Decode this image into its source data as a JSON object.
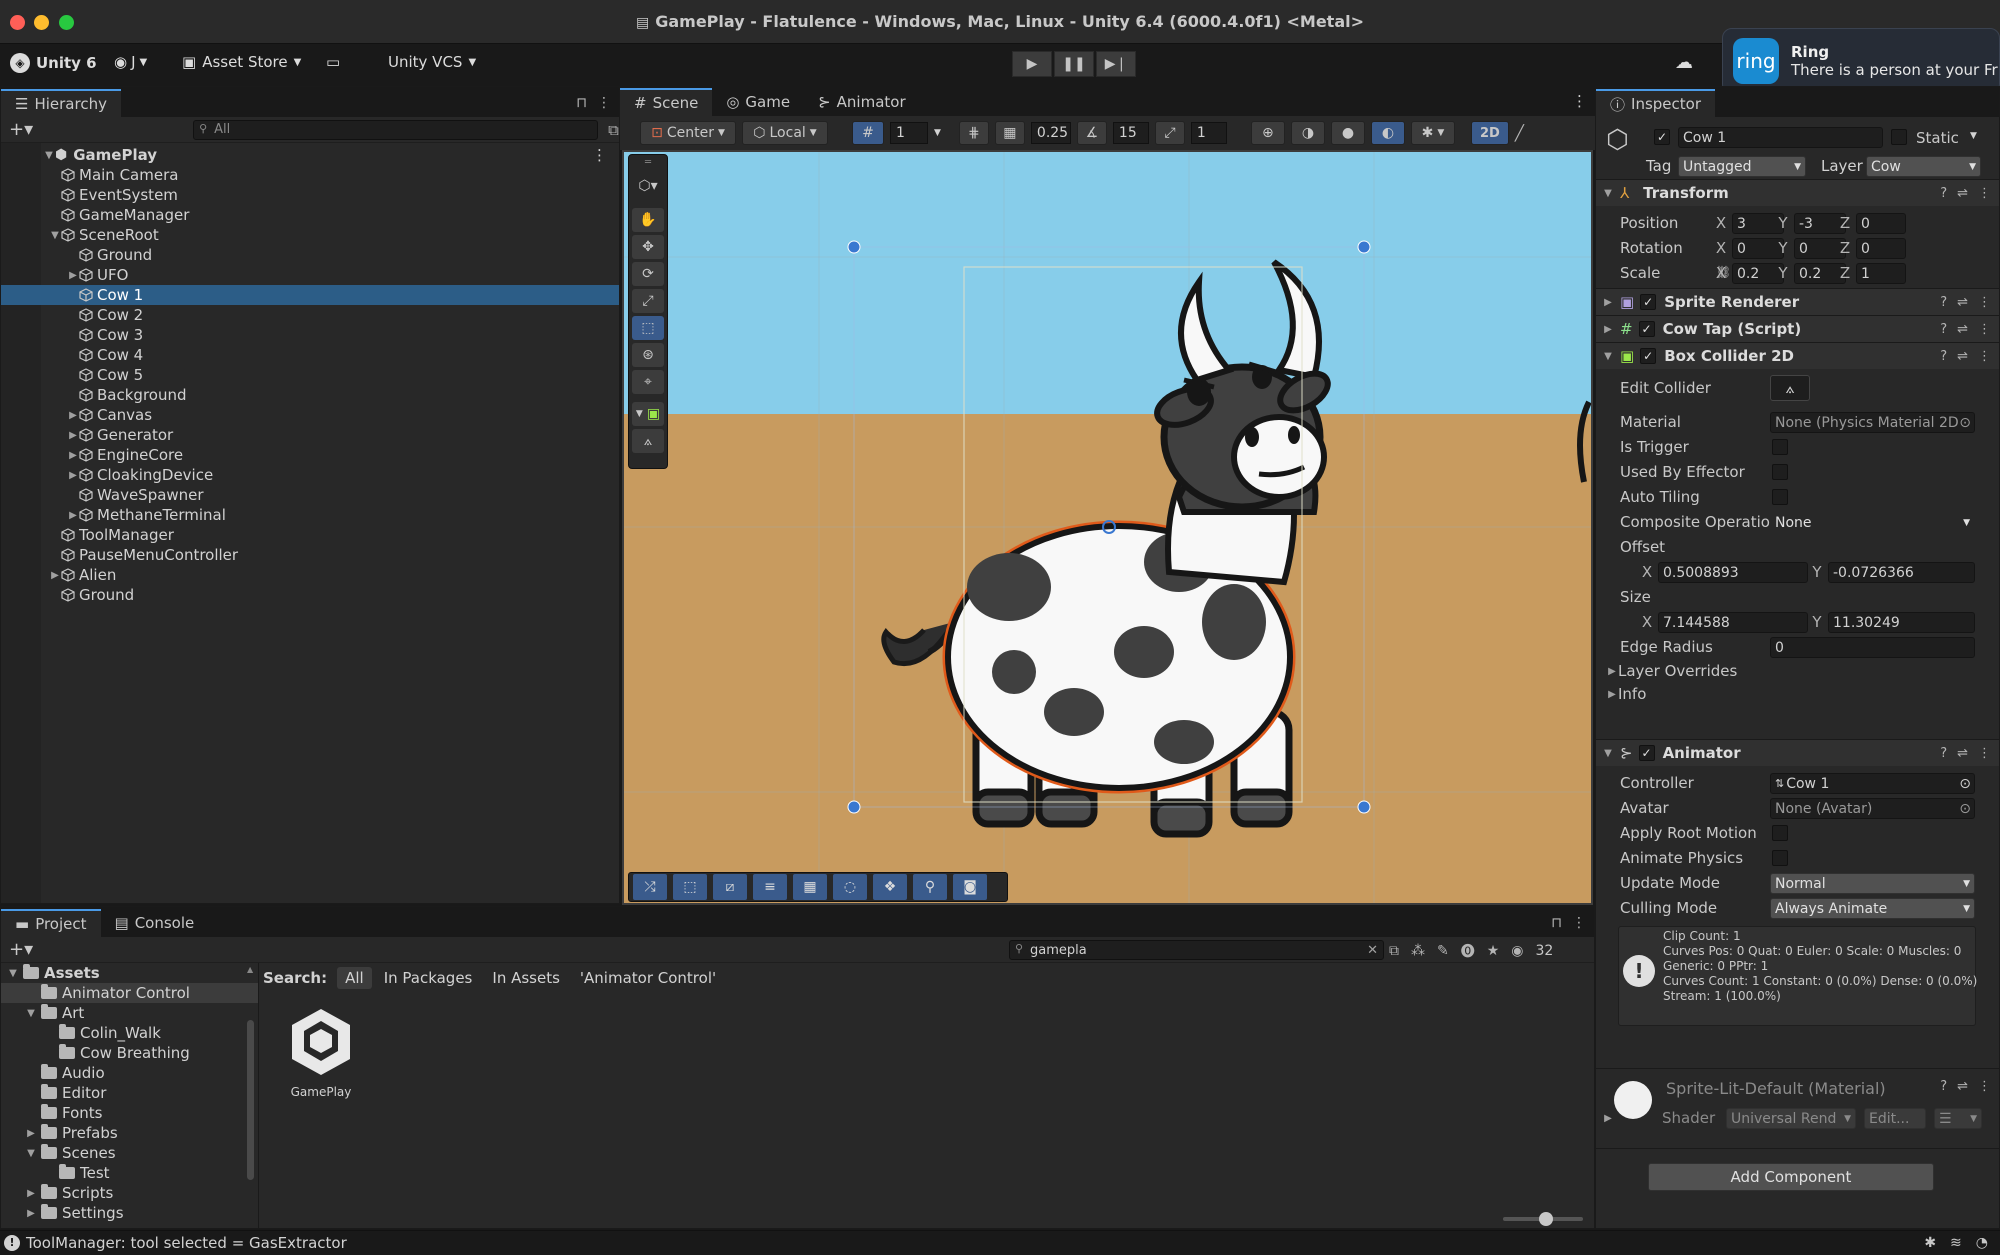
{
  "window": {
    "title": "GamePlay - Flatulence - Windows, Mac, Linux - Unity 6.4 (6000.4.0f1) <Metal>"
  },
  "toolbar": {
    "unity_label": "Unity 6",
    "account_label": "J",
    "asset_store_label": "Asset Store",
    "vcs_label": "Unity VCS"
  },
  "notification": {
    "brand": "ring",
    "title": "Ring",
    "message": "There is a person at your Fr"
  },
  "hierarchy": {
    "tab_label": "Hierarchy",
    "search_placeholder": "All",
    "scene_name": "GamePlay",
    "items": [
      {
        "label": "Main Camera"
      },
      {
        "label": "EventSystem"
      },
      {
        "label": "GameManager"
      },
      {
        "label": "SceneRoot"
      },
      {
        "label": "Ground"
      },
      {
        "label": "UFO"
      },
      {
        "label": "Cow 1"
      },
      {
        "label": "Cow 2"
      },
      {
        "label": "Cow 3"
      },
      {
        "label": "Cow 4"
      },
      {
        "label": "Cow 5"
      },
      {
        "label": "Background"
      },
      {
        "label": "Canvas"
      },
      {
        "label": "Generator"
      },
      {
        "label": "EngineCore"
      },
      {
        "label": "CloakingDevice"
      },
      {
        "label": "WaveSpawner"
      },
      {
        "label": "MethaneTerminal"
      },
      {
        "label": "ToolManager"
      },
      {
        "label": "PauseMenuController"
      },
      {
        "label": "Alien"
      },
      {
        "label": "Ground"
      }
    ]
  },
  "scene": {
    "tabs": [
      {
        "label": "Scene"
      },
      {
        "label": "Game"
      },
      {
        "label": "Animator"
      }
    ],
    "pivot_label": "Center",
    "space_label": "Local",
    "grid_value": "1",
    "snap_value": "0.25",
    "angle_value": "15",
    "scale_snap_value": "1",
    "mode_2d_label": "2D"
  },
  "project": {
    "tabs": [
      {
        "label": "Project"
      },
      {
        "label": "Console"
      }
    ],
    "search_value": "gamepla",
    "count": "32",
    "search_label": "Search:",
    "filters": [
      {
        "label": "All"
      },
      {
        "label": "In Packages"
      },
      {
        "label": "In Assets"
      },
      {
        "label": "'Animator Control'"
      }
    ],
    "tree": [
      {
        "label": "Assets"
      },
      {
        "label": "Animator Control"
      },
      {
        "label": "Art"
      },
      {
        "label": "Colin_Walk"
      },
      {
        "label": "Cow Breathing"
      },
      {
        "label": "Audio"
      },
      {
        "label": "Editor"
      },
      {
        "label": "Fonts"
      },
      {
        "label": "Prefabs"
      },
      {
        "label": "Scenes"
      },
      {
        "label": "Test"
      },
      {
        "label": "Scripts"
      },
      {
        "label": "Settings"
      }
    ],
    "asset_label": "GamePlay"
  },
  "inspector": {
    "tab_label": "Inspector",
    "object_name": "Cow 1",
    "static_label": "Static",
    "tag_label": "Tag",
    "tag_value": "Untagged",
    "layer_label": "Layer",
    "layer_value": "Cow",
    "transform": {
      "title": "Transform",
      "position_label": "Position",
      "position": {
        "x": "3",
        "y": "-3",
        "z": "0"
      },
      "rotation_label": "Rotation",
      "rotation": {
        "x": "0",
        "y": "0",
        "z": "0"
      },
      "scale_label": "Scale",
      "scale": {
        "x": "0.2",
        "y": "0.2",
        "z": "1"
      }
    },
    "sprite_renderer_title": "Sprite Renderer",
    "cow_tap_title": "Cow Tap (Script)",
    "box_collider": {
      "title": "Box Collider 2D",
      "edit_collider_label": "Edit Collider",
      "material_label": "Material",
      "material_value": "None (Physics Material 2D",
      "is_trigger_label": "Is Trigger",
      "used_by_effector_label": "Used By Effector",
      "auto_tiling_label": "Auto Tiling",
      "composite_label": "Composite Operation",
      "composite_value": "None",
      "offset_label": "Offset",
      "offset_x": "0.5008893",
      "offset_y": "-0.0726366",
      "size_label": "Size",
      "size_x": "7.144588",
      "size_y": "11.30249",
      "edge_radius_label": "Edge Radius",
      "edge_radius_value": "0",
      "layer_overrides_label": "Layer Overrides",
      "info_label": "Info"
    },
    "animator": {
      "title": "Animator",
      "controller_label": "Controller",
      "controller_value": "Cow 1",
      "avatar_label": "Avatar",
      "avatar_value": "None (Avatar)",
      "apply_root_label": "Apply Root Motion",
      "animate_physics_label": "Animate Physics",
      "update_mode_label": "Update Mode",
      "update_mode_value": "Normal",
      "culling_mode_label": "Culling Mode",
      "culling_mode_value": "Always Animate",
      "info_lines": [
        "Clip Count: 1",
        "Curves Pos: 0 Quat: 0 Euler: 0 Scale: 0 Muscles: 0",
        "Generic: 0 PPtr: 1",
        "Curves Count: 1 Constant: 0 (0.0%) Dense: 0 (0.0%)",
        "Stream: 1 (100.0%)"
      ]
    },
    "material": {
      "name": "Sprite-Lit-Default (Material)",
      "shader_label": "Shader",
      "shader_value": "Universal Rend",
      "edit_label": "Edit..."
    },
    "add_component_label": "Add Component"
  },
  "status": {
    "message": "ToolManager: tool selected = GasExtractor"
  },
  "colors": {
    "accent": "#4a9ae6",
    "selection": "#2c5d87",
    "sky": "#87cdea",
    "ground": "#c89b5f"
  }
}
